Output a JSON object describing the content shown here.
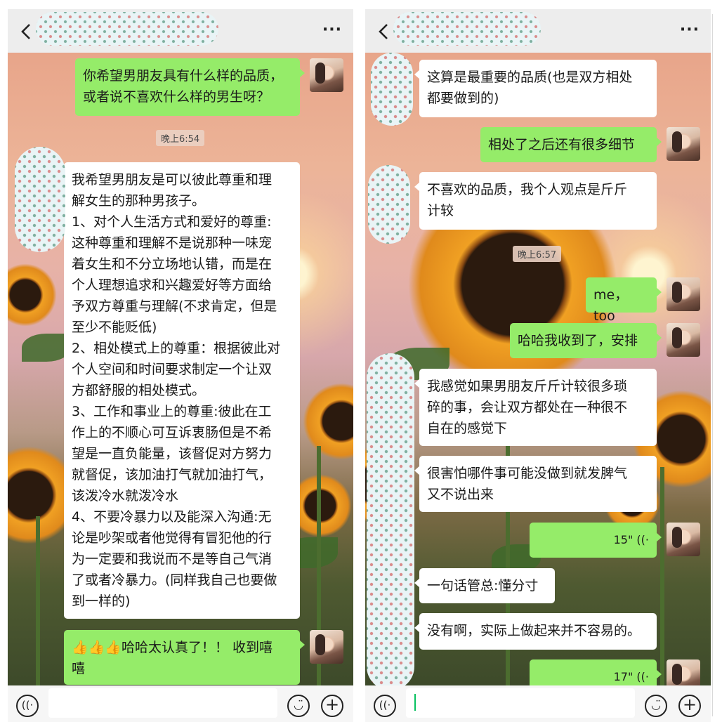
{
  "left": {
    "header": {
      "back": "‹",
      "more": "···"
    },
    "messages": [
      {
        "id": "l1",
        "dir": "out",
        "text": "你希望男朋友具有什么样的品质，\n或者说不喜欢什么样的男生呀？"
      },
      {
        "id": "l2",
        "dir": "in",
        "text": "我希望男朋友是可以彼此尊重和理\n解女生的那种男孩子。\n1、对个人生活方式和爱好的尊重:\n这种尊重和理解不是说那种一味宠\n着女生和不分立场地认错，而是在\n个人理想追求和兴趣爱好等方面给\n予双方尊重与理解(不求肯定，但是\n至少不能贬低)\n2、相处模式上的尊重：根据彼此对\n个人空间和时间要求制定一个让双\n方都舒服的相处模式。\n3、工作和事业上的尊重:彼此在工\n作上的不顺心可互诉衷肠但是不希\n望是一直负能量，该督促对方努力\n就督促，该加油打气就加油打气，\n该泼冷水就泼冷水\n4、不要冷暴力以及能深入沟通:无\n论是吵架或者他觉得有冒犯他的行\n为一定要和我说而不是等自己气消\n了或者冷暴力。(同样我自己也要做\n到一样的)"
      },
      {
        "id": "l3",
        "dir": "out",
        "text": "👍👍👍哈哈太认真了！！ 收到嘻\n嘻"
      }
    ],
    "timestamp": "晚上6:54"
  },
  "right": {
    "header": {
      "back": "‹",
      "more": "···"
    },
    "messages": [
      {
        "id": "r1",
        "dir": "in",
        "text": "这算是最重要的品质(也是双方相处\n都要做到的)"
      },
      {
        "id": "r2",
        "dir": "out",
        "text": "相处了之后还有很多细节"
      },
      {
        "id": "r3",
        "dir": "in",
        "text": "不喜欢的品质，我个人观点是斤斤\n计较"
      },
      {
        "id": "r4",
        "dir": "out",
        "text": "me，too"
      },
      {
        "id": "r5",
        "dir": "out",
        "text": "哈哈我收到了，安排"
      },
      {
        "id": "r6",
        "dir": "in",
        "text": "我感觉如果男朋友斤斤计较很多琐\n碎的事，会让双方都处在一种很不\n自在的感觉下"
      },
      {
        "id": "r7",
        "dir": "in",
        "text": "很害怕哪件事可能没做到就发脾气\n又不说出来"
      },
      {
        "id": "r8",
        "dir": "out",
        "voice": "15\" ((·"
      },
      {
        "id": "r9",
        "dir": "in",
        "text": "一句话管总:懂分寸"
      },
      {
        "id": "r10",
        "dir": "in",
        "text": "没有啊，实际上做起来并不容易的。"
      },
      {
        "id": "r11",
        "dir": "out",
        "voice": "17\" ((·"
      }
    ],
    "timestamp": "晚上6:57"
  },
  "bottom": {
    "voice_icon": "((·",
    "emoji_icon": "◡̈",
    "plus_icon": "+"
  },
  "colors": {
    "outgoing_bubble": "#95ec69",
    "incoming_bubble": "#ffffff",
    "chrome": "#ededed"
  },
  "icons": [
    "chevron-left-icon",
    "more-icon",
    "voice-toggle-icon",
    "emoji-icon",
    "plus-icon"
  ]
}
